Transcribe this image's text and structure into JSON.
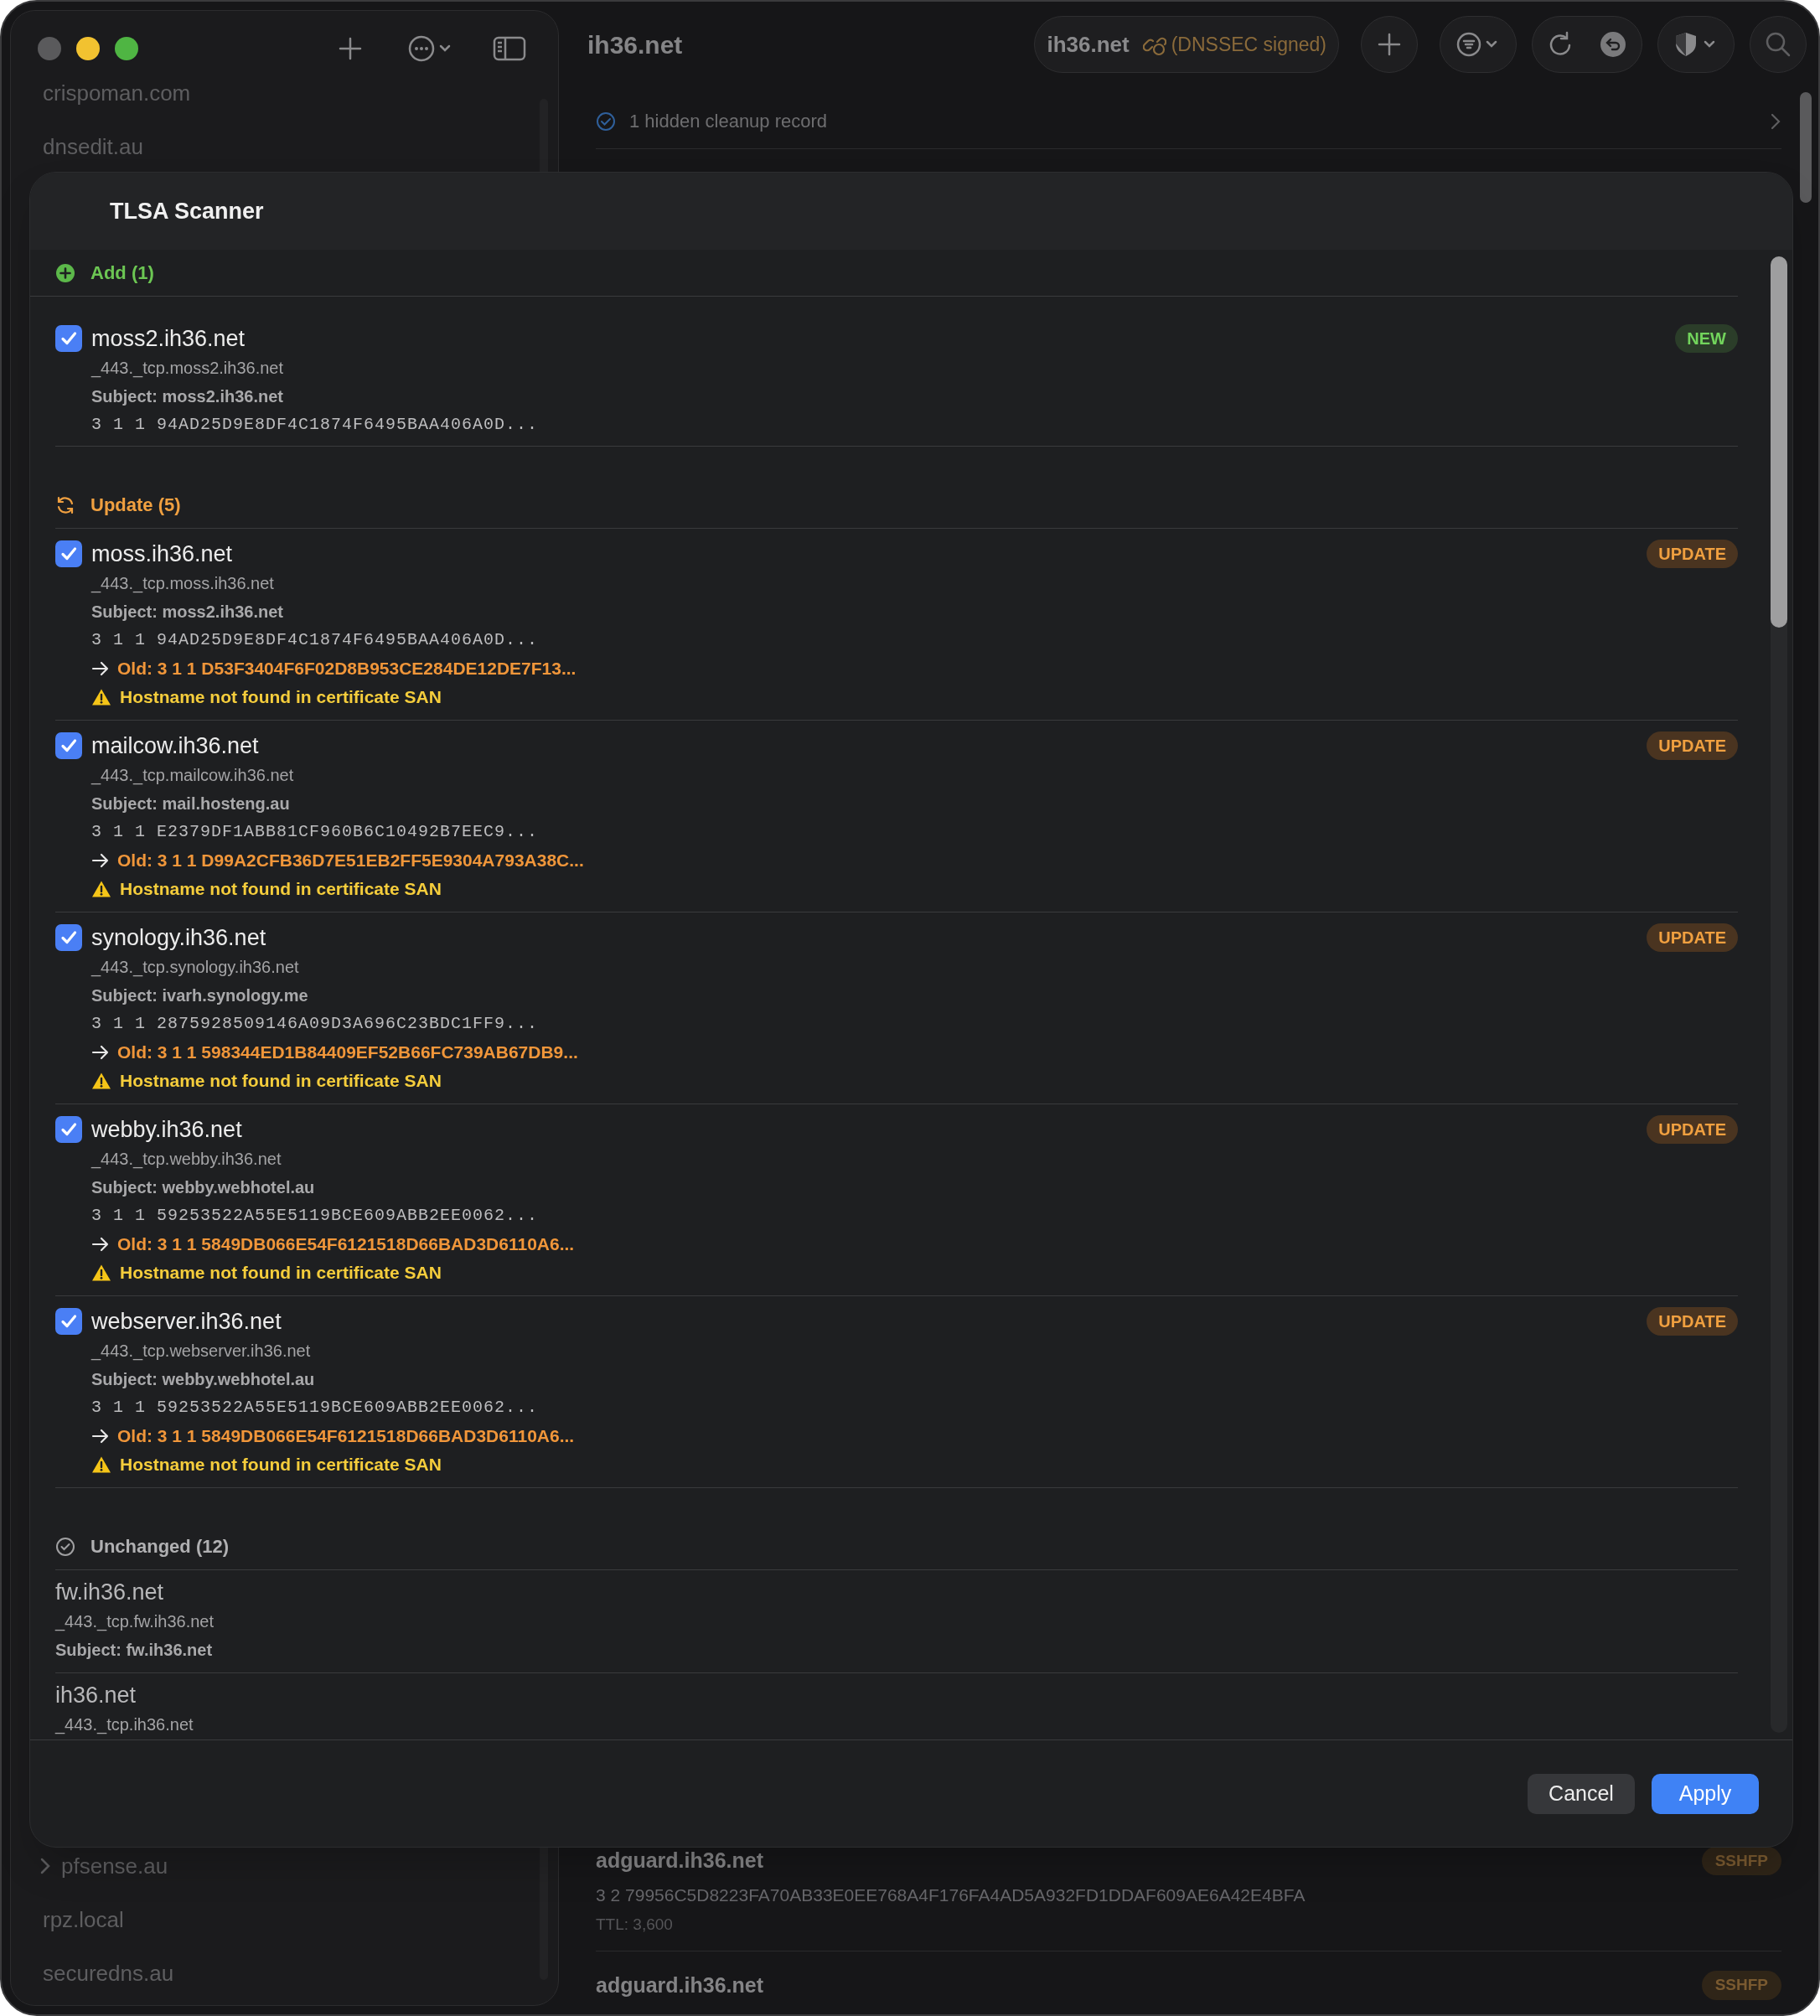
{
  "window": {
    "title": "ih36.net"
  },
  "toolbar": {
    "zone_name": "ih36.net",
    "zone_status": "(DNSSEC signed)"
  },
  "sidebar": {
    "top_items": [
      {
        "label": "crispoman.com",
        "has_children": false
      },
      {
        "label": "dnsedit.au",
        "has_children": false
      }
    ],
    "bottom_items": [
      {
        "label": "pfsense.au",
        "has_children": true
      },
      {
        "label": "rpz.local",
        "has_children": false
      },
      {
        "label": "securedns.au",
        "has_children": false
      }
    ]
  },
  "main": {
    "cleanup_notice": "1 hidden cleanup record",
    "records": [
      {
        "name": "adguard.ih36.net",
        "type": "SSHFP",
        "value": "3 2 79956C5D8223FA70AB33E0EE768A4F176FA4AD5A932FD1DDAF609AE6A42E4BFA",
        "ttl": "TTL: 3,600"
      },
      {
        "name": "adguard.ih36.net",
        "type": "SSHFP"
      }
    ]
  },
  "sheet": {
    "title": "TLSA Scanner",
    "sections": [
      {
        "kind": "add",
        "label": "Add (1)",
        "items": [
          {
            "host": "moss2.ih36.net",
            "record": "_443._tcp.moss2.ih36.net",
            "subject": "Subject: moss2.ih36.net",
            "data": "3 1 1 94AD25D9E8DF4C1874F6495BAA406A0D...",
            "badge": "NEW",
            "checked": true
          }
        ]
      },
      {
        "kind": "update",
        "label": "Update (5)",
        "items": [
          {
            "host": "moss.ih36.net",
            "record": "_443._tcp.moss.ih36.net",
            "subject": "Subject: moss2.ih36.net",
            "data": "3 1 1 94AD25D9E8DF4C1874F6495BAA406A0D...",
            "old": "Old: 3 1 1 D53F3404F6F02D8B953CE284DE12DE7F13...",
            "warning": "Hostname not found in certificate SAN",
            "badge": "UPDATE",
            "checked": true
          },
          {
            "host": "mailcow.ih36.net",
            "record": "_443._tcp.mailcow.ih36.net",
            "subject": "Subject: mail.hosteng.au",
            "data": "3 1 1 E2379DF1ABB81CF960B6C10492B7EEC9...",
            "old": "Old: 3 1 1 D99A2CFB36D7E51EB2FF5E9304A793A38C...",
            "warning": "Hostname not found in certificate SAN",
            "badge": "UPDATE",
            "checked": true
          },
          {
            "host": "synology.ih36.net",
            "record": "_443._tcp.synology.ih36.net",
            "subject": "Subject: ivarh.synology.me",
            "data": "3 1 1 2875928509146A09D3A696C23BDC1FF9...",
            "old": "Old: 3 1 1 598344ED1B84409EF52B66FC739AB67DB9...",
            "warning": "Hostname not found in certificate SAN",
            "badge": "UPDATE",
            "checked": true
          },
          {
            "host": "webby.ih36.net",
            "record": "_443._tcp.webby.ih36.net",
            "subject": "Subject: webby.webhotel.au",
            "data": "3 1 1 59253522A55E5119BCE609ABB2EE0062...",
            "old": "Old: 3 1 1 5849DB066E54F6121518D66BAD3D6110A6...",
            "warning": "Hostname not found in certificate SAN",
            "badge": "UPDATE",
            "checked": true
          },
          {
            "host": "webserver.ih36.net",
            "record": "_443._tcp.webserver.ih36.net",
            "subject": "Subject: webby.webhotel.au",
            "data": "3 1 1 59253522A55E5119BCE609ABB2EE0062...",
            "old": "Old: 3 1 1 5849DB066E54F6121518D66BAD3D6110A6...",
            "warning": "Hostname not found in certificate SAN",
            "badge": "UPDATE",
            "checked": true
          }
        ]
      },
      {
        "kind": "unchanged",
        "label": "Unchanged (12)",
        "items": [
          {
            "host": "fw.ih36.net",
            "record": "_443._tcp.fw.ih36.net",
            "subject": "Subject: fw.ih36.net"
          },
          {
            "host": "ih36.net",
            "record": "_443._tcp.ih36.net"
          }
        ]
      }
    ],
    "buttons": [
      {
        "label": "Cancel",
        "kind": "secondary"
      },
      {
        "label": "Apply",
        "kind": "primary"
      }
    ]
  }
}
